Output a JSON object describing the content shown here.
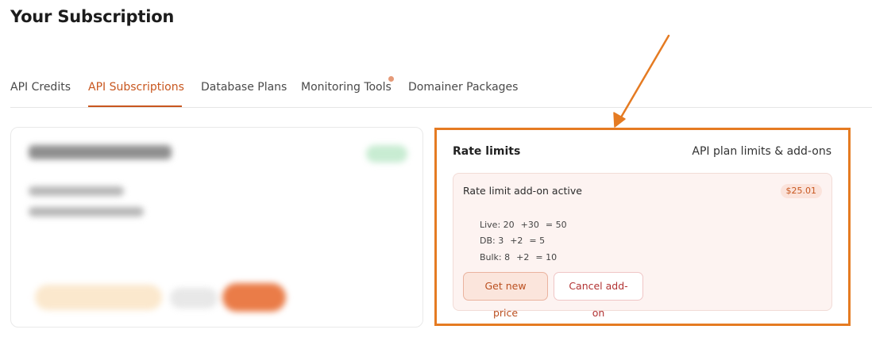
{
  "page": {
    "title": "Your Subscription"
  },
  "tabs": [
    {
      "label": "API Credits",
      "active": false
    },
    {
      "label": "API Subscriptions",
      "active": true
    },
    {
      "label": "Database Plans",
      "active": false
    },
    {
      "label": "Monitoring Tools",
      "active": false,
      "has_notification_dot": true
    },
    {
      "label": "Domainer Packages",
      "active": false
    }
  ],
  "rate_limits": {
    "title": "Rate limits",
    "subtitle": "API plan limits & add-ons",
    "addon": {
      "title": "Rate limit add-on active",
      "price": "$25.01",
      "rows": [
        {
          "label": "Live: 20",
          "added": "+30",
          "total": "= 50"
        },
        {
          "label": "DB: 3",
          "added": "+2",
          "total": "= 5"
        },
        {
          "label": "Bulk: 8",
          "added": "+2",
          "total": "= 10"
        }
      ],
      "buttons": {
        "new_price": "Get new price",
        "cancel": "Cancel add-on"
      }
    }
  },
  "colors": {
    "accent": "#c8571f",
    "highlight": "#e57b22",
    "panel_bg": "#fdf3f1"
  }
}
